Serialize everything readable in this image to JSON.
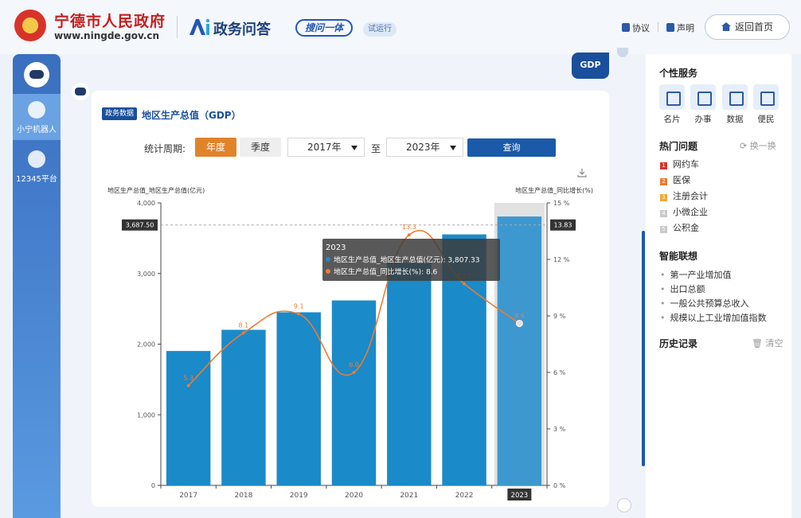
{
  "header": {
    "gov_name": "宁德市人民政府",
    "gov_url": "www.ningde.gov.cn",
    "brand": "政务问答",
    "slogan": "搜问一体",
    "beta": "试运行",
    "links": [
      "协议",
      "声明"
    ],
    "home_button": "返回首页"
  },
  "leftnav": {
    "items": [
      {
        "label": "小宁机器人",
        "active": true
      },
      {
        "label": "12345平台",
        "active": false
      }
    ]
  },
  "chat": {
    "user_message": "GDP"
  },
  "card": {
    "tag": "政务数据",
    "title": "地区生产总值（GDP）",
    "period_label": "统计周期:",
    "period_options": [
      "年度",
      "季度"
    ],
    "active_period": "年度",
    "from_year": "2017年",
    "to_label": "至",
    "to_year": "2023年",
    "query_button": "查询"
  },
  "chart_data": {
    "type": "bar",
    "categories": [
      "2017",
      "2018",
      "2019",
      "2020",
      "2021",
      "2022",
      "2023"
    ],
    "series": [
      {
        "name": "地区生产总值_地区生产总值(亿元)",
        "type": "bar",
        "values": [
          1903.0,
          2203.0,
          2451.0,
          2619.0,
          3151.0,
          3554.0,
          3807.33
        ]
      },
      {
        "name": "地区生产总值_同比增长(%)",
        "type": "line",
        "values": [
          5.3,
          8.1,
          9.1,
          6.0,
          13.3,
          10.7,
          8.6
        ]
      }
    ],
    "ylabel_left": "地区生产总值_地区生产总值(亿元)",
    "ylabel_right": "地区生产总值_同比增长(%)",
    "ylim_left": [
      0,
      4000
    ],
    "ylim_right": [
      0,
      15
    ],
    "yticks_left": [
      "0",
      "1,000",
      "2,000",
      "3,000",
      "4,000"
    ],
    "yticks_right": [
      "0 %",
      "3 %",
      "6 %",
      "9 %",
      "12 %",
      "15 %"
    ],
    "crosshair": {
      "left_value": "3,687.50",
      "right_value": "13.83",
      "x_label": "2023"
    },
    "tooltip": {
      "title": "2023",
      "lines": [
        "地区生产总值_地区生产总值(亿元): 3,807.33",
        "地区生产总值_同比增长(%): 8.6"
      ]
    },
    "colors": {
      "bar": "#1a8ac9",
      "bar_highlight": "#3d98cf",
      "line": "#ee7b32"
    }
  },
  "sidebar": {
    "personal_title": "个性服务",
    "services": [
      "名片",
      "办事",
      "数据",
      "便民"
    ],
    "hot_title": "热门问题",
    "swap_label": "换一换",
    "hot_items": [
      {
        "rank": "1",
        "text": "网约车",
        "color": "#d8342a"
      },
      {
        "rank": "2",
        "text": "医保",
        "color": "#ea7a2c"
      },
      {
        "rank": "3",
        "text": "注册会计",
        "color": "#f0a830"
      },
      {
        "rank": "4",
        "text": "小微企业",
        "color": "#c9c9c9"
      },
      {
        "rank": "5",
        "text": "公积金",
        "color": "#c9c9c9"
      }
    ],
    "assoc_title": "智能联想",
    "assoc_items": [
      "第一产业增加值",
      "出口总额",
      "一般公共预算总收入",
      "规模以上工业增加值指数"
    ],
    "history_title": "历史记录",
    "clear_label": "清空"
  }
}
